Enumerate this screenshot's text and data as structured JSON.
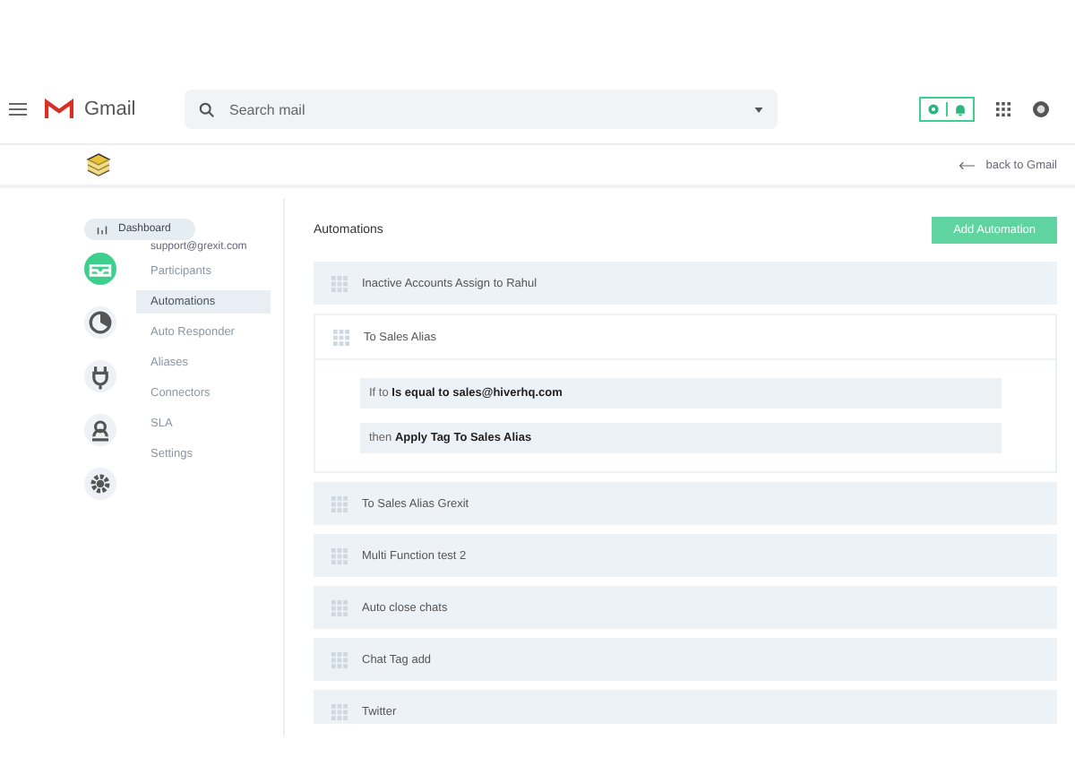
{
  "gmail_bar": {
    "app_name": "Gmail",
    "search": {
      "placeholder": "Search mail"
    }
  },
  "hiver_bar": {
    "back_link": "back to Gmail"
  },
  "sidebar": {
    "tooltip": "Dashboard",
    "account": "support@grexit.com",
    "rail": [
      {
        "kind": "inbox",
        "selected": true
      },
      {
        "kind": "pie",
        "selected": false
      },
      {
        "kind": "plug",
        "selected": false
      },
      {
        "kind": "person",
        "selected": false
      },
      {
        "kind": "gear",
        "selected": false
      }
    ],
    "items": [
      {
        "label": "Participants",
        "selected": false
      },
      {
        "label": "Automations",
        "selected": true
      },
      {
        "label": "Auto Responder",
        "selected": false
      },
      {
        "label": "Aliases",
        "selected": false
      },
      {
        "label": "Connectors",
        "selected": false
      },
      {
        "label": "SLA",
        "selected": false
      },
      {
        "label": "Settings",
        "selected": false
      }
    ]
  },
  "main": {
    "title": "Automations",
    "add_button": "Add Automation",
    "automations": [
      {
        "name": "Inactive Accounts Assign to Rahul",
        "expanded": false
      },
      {
        "name": "To Sales Alias",
        "expanded": true,
        "conditions": [
          {
            "prefix": "If to",
            "rule": "Is equal to sales@hiverhq.com"
          },
          {
            "prefix": "then",
            "rule": "Apply Tag To Sales Alias"
          }
        ]
      },
      {
        "name": "To Sales Alias Grexit",
        "expanded": false
      },
      {
        "name": "Multi Function test 2",
        "expanded": false
      },
      {
        "name": "Auto close chats",
        "expanded": false
      },
      {
        "name": "Chat Tag add",
        "expanded": false
      },
      {
        "name": "Twitter",
        "expanded": false
      }
    ]
  }
}
